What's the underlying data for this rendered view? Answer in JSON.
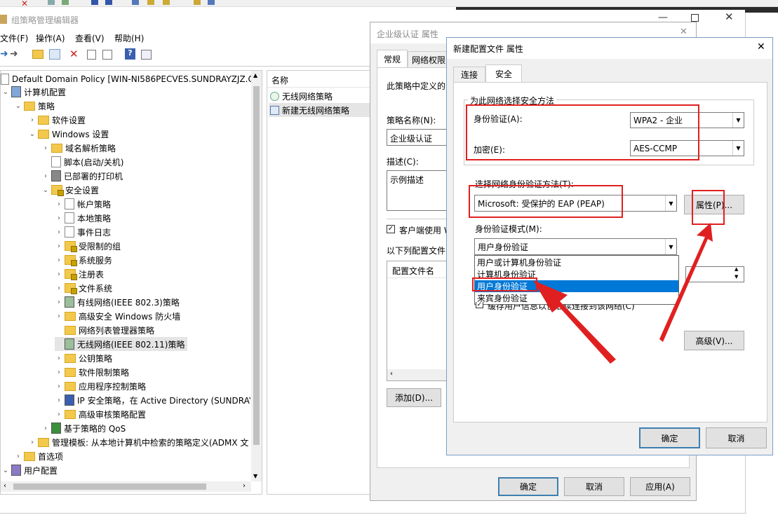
{
  "main_window": {
    "title": "组策略管理编辑器",
    "menu": [
      "文件(F)",
      "操作(A)",
      "查看(V)",
      "帮助(H)"
    ],
    "tree": {
      "root": "Default Domain Policy [WIN-NI586PECVES.SUNDRAYZJZ.C",
      "items": [
        {
          "label": "计算机配置"
        },
        {
          "label": "策略"
        },
        {
          "label": "软件设置"
        },
        {
          "label": "Windows 设置"
        },
        {
          "label": "域名解析策略"
        },
        {
          "label": "脚本(启动/关机)"
        },
        {
          "label": "已部署的打印机"
        },
        {
          "label": "安全设置"
        },
        {
          "label": "帐户策略"
        },
        {
          "label": "本地策略"
        },
        {
          "label": "事件日志"
        },
        {
          "label": "受限制的组"
        },
        {
          "label": "系统服务"
        },
        {
          "label": "注册表"
        },
        {
          "label": "文件系统"
        },
        {
          "label": "有线网络(IEEE 802.3)策略"
        },
        {
          "label": "高级安全 Windows 防火墙"
        },
        {
          "label": "网络列表管理器策略"
        },
        {
          "label": "无线网络(IEEE 802.11)策略"
        },
        {
          "label": "公钥策略"
        },
        {
          "label": "软件限制策略"
        },
        {
          "label": "应用程序控制策略"
        },
        {
          "label": "IP 安全策略，在 Active Directory (SUNDRAY"
        },
        {
          "label": "高级审核策略配置"
        },
        {
          "label": "基于策略的 QoS"
        },
        {
          "label": "管理模板: 从本地计算机中检索的策略定义(ADMX 文"
        },
        {
          "label": "首选项"
        },
        {
          "label": "用户配置"
        }
      ]
    },
    "list": {
      "header": "名称",
      "items": [
        "无线网络策略",
        "新建无线网络策略"
      ]
    }
  },
  "enterprise_dialog": {
    "title": "企业级认证 属性",
    "tabs": [
      "常规",
      "网络权限"
    ],
    "desc_text": "此策略中定义的",
    "policy_name_label": "策略名称(N):",
    "policy_name_value": "企业级认证",
    "description_label": "描述(C):",
    "description_value": "示例描述",
    "client_checkbox": "客户端使用 W",
    "profiles_label": "以下列配置文件",
    "profiles_header": "配置文件名",
    "add_button": "添加(D)...",
    "ok": "确定",
    "cancel": "取消",
    "apply": "应用(A)"
  },
  "profile_dialog": {
    "title": "新建配置文件 属性",
    "tabs": [
      "连接",
      "安全"
    ],
    "group_title": "为此网络选择安全方法",
    "auth_label": "身份验证(A):",
    "auth_value": "WPA2 - 企业",
    "encrypt_label": "加密(E):",
    "encrypt_value": "AES-CCMP",
    "method_label": "选择网络身份验证方法(T):",
    "method_value": "Microsoft: 受保护的 EAP (PEAP)",
    "properties_button": "属性(P)...",
    "mode_label": "身份验证模式(M):",
    "mode_value": "用户身份验证",
    "mode_options": [
      "用户或计算机身份验证",
      "计算机身份验证",
      "用户身份验证",
      "来宾身份验证"
    ],
    "mode_selected_index": 2,
    "cache_checkbox": "缓存用户信息以便后续连接到该网络(C)",
    "advanced_button": "高级(V)...",
    "ok": "确定",
    "cancel": "取消"
  },
  "colors": {
    "highlight": "#0078d7",
    "annotation_red": "#e02020",
    "window_border": "#7a9ec9"
  }
}
